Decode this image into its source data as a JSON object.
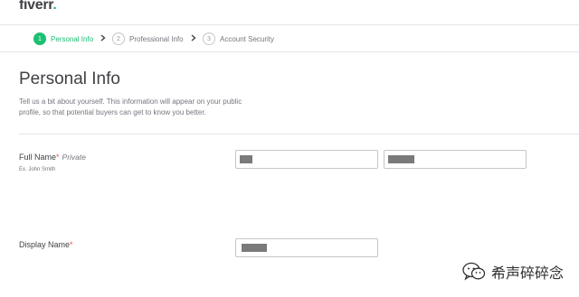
{
  "header": {
    "logo_text": "fiverr",
    "logo_dot": ".",
    "brand_color": "#1dbf73"
  },
  "steps": [
    {
      "number": "1",
      "label": "Personal Info",
      "active": true
    },
    {
      "number": "2",
      "label": "Professional Info",
      "active": false
    },
    {
      "number": "3",
      "label": "Account Security",
      "active": false
    }
  ],
  "main": {
    "title": "Personal Info",
    "description": "Tell us a bit about yourself. This information will appear on your public profile, so that potential buyers can get to know you better."
  },
  "full_name": {
    "label": "Full Name",
    "required_mark": "*",
    "private_text": "Private",
    "hint": "Ex. John Smith",
    "first_name_value": "",
    "last_name_value": ""
  },
  "display_name": {
    "label": "Display Name",
    "required_mark": "*",
    "value": ""
  },
  "watermark": {
    "text": "希声碎碎念",
    "icon": "wechat-icon"
  }
}
